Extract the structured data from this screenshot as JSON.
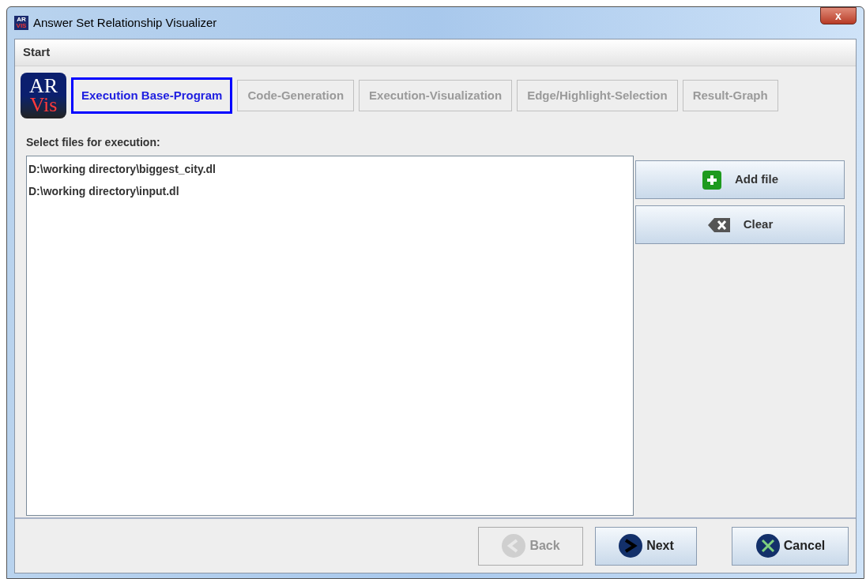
{
  "window": {
    "title": "Answer Set Relationship Visualizer",
    "icon_text": [
      "AR",
      "VIS"
    ],
    "close": "x"
  },
  "menu": [
    "Start"
  ],
  "logo": {
    "top": "AR",
    "bottom": "Vis"
  },
  "steps": [
    {
      "label": "Execution Base-Program",
      "selected": true
    },
    {
      "label": "Code-Generation",
      "selected": false
    },
    {
      "label": "Execution-Visualization",
      "selected": false
    },
    {
      "label": "Edge/Highlight-Selection",
      "selected": false
    },
    {
      "label": "Result-Graph",
      "selected": false
    }
  ],
  "files_label": "Select files for execution:",
  "files": [
    "D:\\working directory\\biggest_city.dl",
    "D:\\working directory\\input.dl"
  ],
  "side_buttons": [
    {
      "label": "Add file",
      "kind": "add"
    },
    {
      "label": "Clear",
      "kind": "clear"
    }
  ],
  "footer_buttons": [
    {
      "label": "Back",
      "kind": "back",
      "disabled": true
    },
    {
      "label": "Next",
      "kind": "next",
      "disabled": false
    },
    {
      "label": "Cancel",
      "kind": "cancel",
      "disabled": false
    }
  ]
}
